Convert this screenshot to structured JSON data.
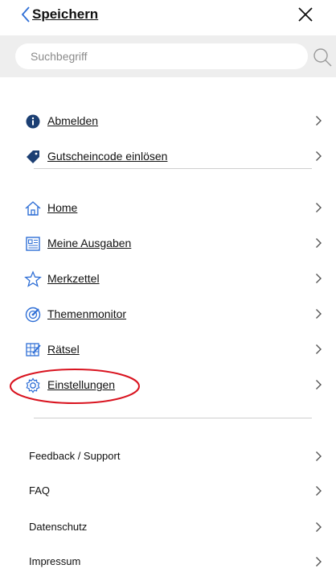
{
  "header": {
    "back_label": "Speichern"
  },
  "search": {
    "placeholder": "Suchbegriff"
  },
  "account_items": [
    {
      "label": "Abmelden",
      "icon": "info-icon"
    },
    {
      "label": "Gutscheincode einlösen",
      "icon": "tag-icon"
    }
  ],
  "nav_items": [
    {
      "label": "Home",
      "icon": "home-icon"
    },
    {
      "label": "Meine Ausgaben",
      "icon": "newspaper-icon"
    },
    {
      "label": "Merkzettel",
      "icon": "star-icon"
    },
    {
      "label": "Themenmonitor",
      "icon": "target-icon"
    },
    {
      "label": "Rätsel",
      "icon": "puzzle-grid-icon"
    },
    {
      "label": "Einstellungen",
      "icon": "gear-icon"
    }
  ],
  "info_items": [
    {
      "label": "Feedback / Support"
    },
    {
      "label": "FAQ"
    },
    {
      "label": "Datenschutz"
    },
    {
      "label": "Impressum"
    }
  ],
  "colors": {
    "accent": "#2f6fd6",
    "highlight": "#d9131f"
  }
}
